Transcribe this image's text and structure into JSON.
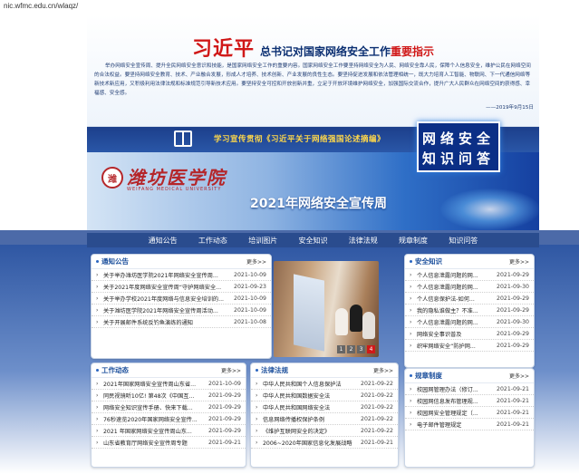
{
  "url": "nic.wfmc.edu.cn/wlaqz/",
  "banner": {
    "name": "习近平",
    "subtitle_before": "总书记对国家网络安全工作",
    "subtitle_highlight": "重要指示",
    "body": "举办网络安全宣传周、提升全民网络安全意识和技能，是国家网络安全工作的重要内容。国家网络安全工作要坚持网络安全为人民、网络安全靠人民，保障个人信息安全，维护公民在网络空间的合法权益。要坚持网络安全教育、技术、产业融合发展，形成人才培养、技术创新、产业发展的良性生态。要坚持促进发展和依法管理相统一，既大力培育人工智能、物联网、下一代通信网络等新技术新应用，又积极利用法律法规和标准规范引导新技术应用。要坚持安全可控和开放创新并重，立足于开放环境维护网络安全，加强国际交流合作，提升广大人民群众在网络空间的获得感、幸福感、安全感。",
    "date": "——2019年9月15日"
  },
  "strip_text": "学习宣传贯彻《习近平关于网络强国论述摘编》",
  "logo": {
    "glyph": "潍",
    "cn": "潍坊医学院",
    "en": "WEIFANG MEDICAL UNIVERSITY"
  },
  "hero_title": "2021年网络安全宣传周",
  "quiz": {
    "line1": "网络安全",
    "line2": "知识问答"
  },
  "nav": [
    "通知公告",
    "工作动态",
    "培训图片",
    "安全知识",
    "法律法规",
    "规章制度",
    "知识问答"
  ],
  "more_label": "更多>>",
  "notice": {
    "title": "通知公告",
    "items": [
      {
        "text": "关于举办潍坊医学院2021年网络安全宣传周...",
        "date": "2021-10-09"
      },
      {
        "text": "关于2021年度网络安全宣传周“守护网络安全...",
        "date": "2021-09-23"
      },
      {
        "text": "关于举办学校2021年度网络与信息安全培训的...",
        "date": "2021-10-09"
      },
      {
        "text": "关于潍坊医学院2021年网络安全宣传周活动...",
        "date": "2021-10-09"
      },
      {
        "text": "关于开展邮件系统反钓鱼演练的通知",
        "date": "2021-10-08"
      }
    ]
  },
  "pager": [
    "1",
    "2",
    "3",
    "4"
  ],
  "knowledge": {
    "title": "安全知识",
    "items": [
      {
        "text": "个人信息泄露问题的网...",
        "date": "2021-09-29"
      },
      {
        "text": "个人信息泄露问题的网...",
        "date": "2021-09-30"
      },
      {
        "text": "个人信息保护法-如何...",
        "date": "2021-09-29"
      },
      {
        "text": "我的隐私谁做主？不准...",
        "date": "2021-09-29"
      },
      {
        "text": "个人信息泄露问题的网...",
        "date": "2021-09-30"
      },
      {
        "text": "网络安全事识普及",
        "date": "2021-09-29"
      },
      {
        "text": "织牢网络安全“防护网...",
        "date": "2021-09-29"
      }
    ]
  },
  "work": {
    "title": "工作动态",
    "items": [
      {
        "text": "2021年国家网络安全宣传周山东省...",
        "date": "2021-10-09"
      },
      {
        "text": "同民视镜听10亿! 第48次《中国互...",
        "date": "2021-09-29"
      },
      {
        "text": "网络安全知识宣传手册、快来下载...",
        "date": "2021-09-29"
      },
      {
        "text": "76秒速览2020年国家网络安全宣传...",
        "date": "2021-09-29"
      },
      {
        "text": "2021 年国家网络安全宣传周山东...",
        "date": "2021-09-29"
      },
      {
        "text": "山东省教育厅网络安全宣传周专题",
        "date": "2021-09-21"
      }
    ]
  },
  "law": {
    "title": "法律法规",
    "items": [
      {
        "text": "中华人民共和国个人信息保护法",
        "date": "2021-09-22"
      },
      {
        "text": "中华人民共和国数据安全法",
        "date": "2021-09-22"
      },
      {
        "text": "中华人民共和国网络安全法",
        "date": "2021-09-22"
      },
      {
        "text": "信息网络传播权保护条例",
        "date": "2021-09-22"
      },
      {
        "text": "《维护互联网安全的决定》",
        "date": "2021-09-22"
      },
      {
        "text": "2006~2020年国家信息化发展战略",
        "date": "2021-09-21"
      }
    ]
  },
  "rules": {
    "title": "规章制度",
    "items": [
      {
        "text": "校园网管理办法（修订...",
        "date": "2021-09-21"
      },
      {
        "text": "校园网信息发布管理规...",
        "date": "2021-09-21"
      },
      {
        "text": "校园网安全管理规定（...",
        "date": "2021-09-21"
      },
      {
        "text": "电子邮件管理规定",
        "date": "2021-09-21"
      }
    ]
  }
}
